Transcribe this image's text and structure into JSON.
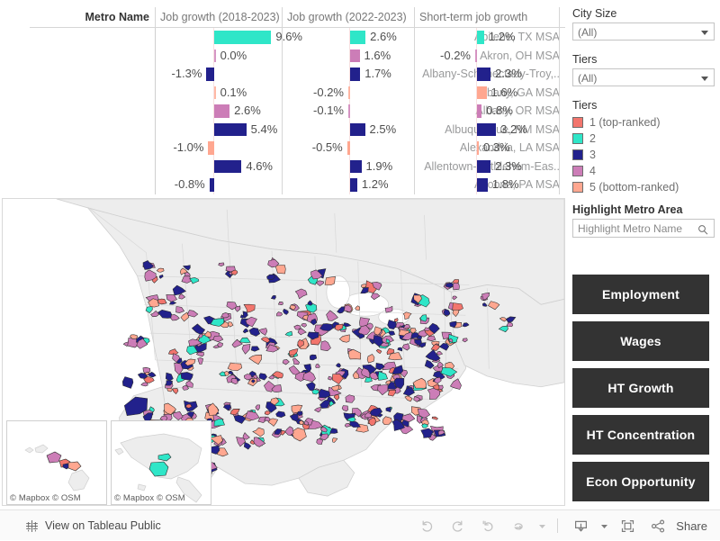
{
  "table": {
    "columns": [
      {
        "key": "metro",
        "label": "Metro Name"
      },
      {
        "key": "g1823",
        "label": "Job growth (2018-2023)"
      },
      {
        "key": "g2223",
        "label": "Job growth (2022-2023)"
      },
      {
        "key": "stg",
        "label": "Short-term job growth"
      }
    ],
    "rows": [
      {
        "metro": "Abilene, TX MSA",
        "g1823": "9.6%",
        "g1823_v": 9.6,
        "g1823_tier": 2,
        "g2223": "2.6%",
        "g2223_v": 2.6,
        "g2223_tier": 2,
        "stg": "1.2%",
        "stg_v": 1.2,
        "stg_tier": 2
      },
      {
        "metro": "Akron, OH MSA",
        "g1823": "0.0%",
        "g1823_v": 0.0,
        "g1823_tier": 4,
        "g2223": "1.6%",
        "g2223_v": 1.6,
        "g2223_tier": 4,
        "stg": "-0.2%",
        "stg_v": -0.2,
        "stg_tier": 4
      },
      {
        "metro": "Albany-Schenectady-Troy,..",
        "g1823": "-1.3%",
        "g1823_v": -1.3,
        "g1823_tier": 3,
        "g2223": "1.7%",
        "g2223_v": 1.7,
        "g2223_tier": 3,
        "stg": "2.3%",
        "stg_v": 2.3,
        "stg_tier": 3
      },
      {
        "metro": "Albany, GA MSA",
        "g1823": "0.1%",
        "g1823_v": 0.1,
        "g1823_tier": 5,
        "g2223": "-0.2%",
        "g2223_v": -0.2,
        "g2223_tier": 5,
        "stg": "1.6%",
        "stg_v": 1.6,
        "stg_tier": 5
      },
      {
        "metro": "Albany, OR MSA",
        "g1823": "2.6%",
        "g1823_v": 2.6,
        "g1823_tier": 4,
        "g2223": "-0.1%",
        "g2223_v": -0.1,
        "g2223_tier": 4,
        "stg": "0.8%",
        "stg_v": 0.8,
        "stg_tier": 4
      },
      {
        "metro": "Albuquerque, NM MSA",
        "g1823": "5.4%",
        "g1823_v": 5.4,
        "g1823_tier": 3,
        "g2223": "2.5%",
        "g2223_v": 2.5,
        "g2223_tier": 3,
        "stg": "3.2%",
        "stg_v": 3.2,
        "stg_tier": 3
      },
      {
        "metro": "Alexandria, LA MSA",
        "g1823": "-1.0%",
        "g1823_v": -1.0,
        "g1823_tier": 5,
        "g2223": "-0.5%",
        "g2223_v": -0.5,
        "g2223_tier": 5,
        "stg": "0.3%",
        "stg_v": 0.3,
        "stg_tier": 5
      },
      {
        "metro": "Allentown-Bethlehem-Eas..",
        "g1823": "4.6%",
        "g1823_v": 4.6,
        "g1823_tier": 3,
        "g2223": "1.9%",
        "g2223_v": 1.9,
        "g2223_tier": 3,
        "stg": "2.3%",
        "stg_v": 2.3,
        "stg_tier": 3
      },
      {
        "metro": "Altoona, PA MSA",
        "g1823": "-0.8%",
        "g1823_v": -0.8,
        "g1823_tier": 3,
        "g2223": "1.2%",
        "g2223_v": 1.2,
        "g2223_tier": 3,
        "stg": "1.8%",
        "stg_v": 1.8,
        "stg_tier": 3
      }
    ]
  },
  "filters": {
    "city_size": {
      "label": "City Size",
      "value": "(All)"
    },
    "tiers": {
      "label": "Tiers",
      "value": "(All)"
    }
  },
  "legend": {
    "title": "Tiers",
    "items": [
      {
        "label": "1 (top-ranked)",
        "color": "#F2756D"
      },
      {
        "label": "2",
        "color": "#2FE6C8"
      },
      {
        "label": "3",
        "color": "#22218C"
      },
      {
        "label": "4",
        "color": "#CC7DB7"
      },
      {
        "label": "5 (bottom-ranked)",
        "color": "#FFA790"
      }
    ]
  },
  "highlight": {
    "label": "Highlight Metro Area",
    "placeholder": "Highlight Metro Name",
    "value": "",
    "icon": "magnifier-icon"
  },
  "buttons": [
    {
      "label": "Employment"
    },
    {
      "label": "Wages"
    },
    {
      "label": "HT Growth"
    },
    {
      "label": "HT Concentration"
    },
    {
      "label": "Econ Opportunity"
    }
  ],
  "map": {
    "attribution": "© Mapbox  © OSM",
    "insets": [
      {
        "name": "hawaii-inset",
        "attribution": "© Mapbox  © OSM"
      },
      {
        "name": "alaska-inset",
        "attribution": "© Mapbox  © OSM"
      }
    ]
  },
  "bottombar": {
    "tableau_link": "View on Tableau Public",
    "share_label": "Share",
    "tools": [
      "undo-icon",
      "redo-icon",
      "revert-icon",
      "refresh-icon",
      "pause-dropdown-icon",
      "download-icon",
      "fullscreen-icon",
      "share-icon"
    ]
  },
  "colors": {
    "tier1": "#F2756D",
    "tier2": "#2FE6C8",
    "tier3": "#22218C",
    "tier4": "#CC7DB7",
    "tier5": "#FFA790",
    "button_bg": "#333333",
    "map_land": "#EDEDED",
    "map_water": "#FFFFFF"
  }
}
